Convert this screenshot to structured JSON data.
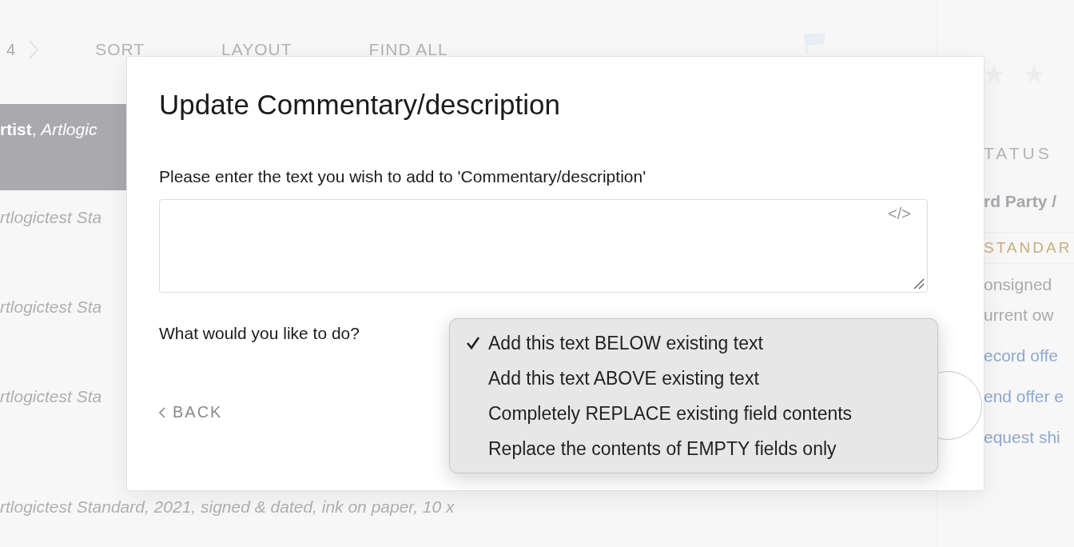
{
  "toolbar": {
    "page_count": "4",
    "actions": [
      "SORT",
      "LAYOUT",
      "FIND ALL"
    ]
  },
  "list": {
    "rows": [
      {
        "text": "**rtist**, *Artlogic*",
        "selected": true
      },
      {
        "text": "rtlogictest Sta",
        "selected": false
      },
      {
        "text": "rtlogictest Sta",
        "selected": false
      },
      {
        "text": "rtlogictest Sta",
        "selected": false
      },
      {
        "text": "rtlogictest Standard, 2021, signed & dated, ink on paper, 10 x",
        "selected": false
      }
    ]
  },
  "side_panel": {
    "heading": "TATUS",
    "owner_type": "rd Party /",
    "tag": "STANDAR",
    "facts": [
      "onsigned",
      "urrent ow"
    ],
    "links": [
      "ecord offe",
      "end offer e",
      "equest shi"
    ]
  },
  "dialog": {
    "title": "Update Commentary/description",
    "prompt": "Please enter the text you wish to add to 'Commentary/description'",
    "code_toggle": "</>",
    "question": "What would you like to do?",
    "back": "BACK",
    "options": [
      {
        "label": "Add this text BELOW existing text",
        "selected": true
      },
      {
        "label": "Add this text ABOVE existing text",
        "selected": false
      },
      {
        "label": "Completely REPLACE existing field contents",
        "selected": false
      },
      {
        "label": "Replace the contents of EMPTY fields only",
        "selected": false
      }
    ]
  }
}
